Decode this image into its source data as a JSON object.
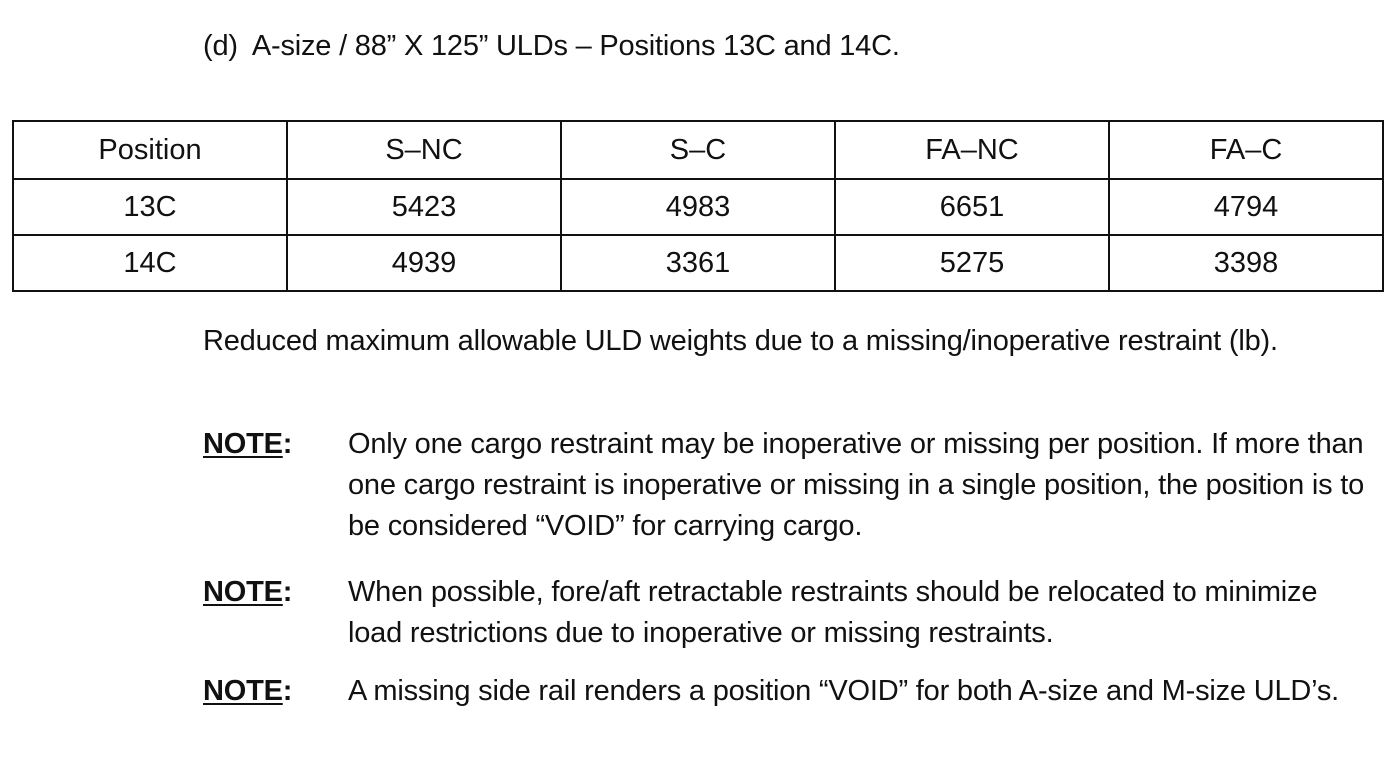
{
  "heading": {
    "label": "(d)",
    "text": "A-size / 88” X 125” ULDs – Positions 13C and 14C."
  },
  "table": {
    "columns": [
      "Position",
      "S–NC",
      "S–C",
      "FA–NC",
      "FA–C"
    ],
    "rows": [
      [
        "13C",
        "5423",
        "4983",
        "6651",
        "4794"
      ],
      [
        "14C",
        "4939",
        "3361",
        "5275",
        "3398"
      ]
    ]
  },
  "caption": "Reduced maximum allowable ULD weights due to a missing/inoperative restraint (lb).",
  "notes": [
    {
      "label": "NOTE",
      "text": "Only one cargo restraint may be inoperative or missing per position.  If more than one cargo restraint is inoperative or missing in a single position, the position is to be considered “VOID” for carrying cargo."
    },
    {
      "label": "NOTE",
      "text": "When possible, fore/aft retractable restraints should be relocated to minimize load restrictions due to inoperative or missing restraints."
    },
    {
      "label": "NOTE",
      "text": "A missing side rail renders a position “VOID” for both A-size and M-size ULD’s."
    }
  ]
}
